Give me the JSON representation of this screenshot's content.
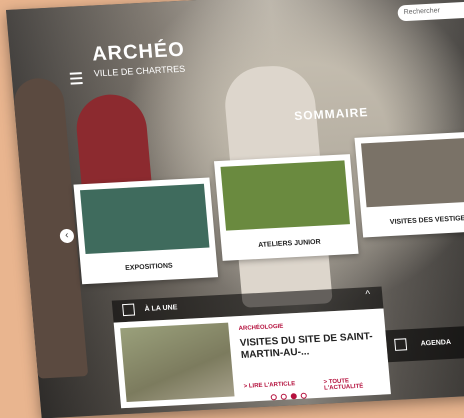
{
  "header": {
    "title": "ARCHÉO",
    "subtitle": "VILLE DE CHARTRES",
    "search_placeholder": "Rechercher"
  },
  "summary": {
    "title": "SOMMAIRE",
    "cards": [
      {
        "label": "EXPOSITIONS",
        "thumb_color": "#3f6b5d"
      },
      {
        "label": "ATELIERS JUNIOR",
        "thumb_color": "#6a8a3f"
      },
      {
        "label": "VISITES DES VESTIGES",
        "thumb_color": "#7a7267"
      }
    ],
    "prev_arrow": "‹"
  },
  "news": {
    "bar_label": "À LA UNE",
    "collapse_icon": "^",
    "category": "ARCHÉOLOGIE",
    "title": "VISITES DU SITE DE SAINT-MARTIN-AU-...",
    "read_link": "> LIRE L'ARTICLE",
    "all_link": "> TOUTE L'ACTUALITÉ",
    "dots_total": 4,
    "dots_active_index": 2
  },
  "bottom": {
    "agenda_label": "AGENDA"
  },
  "colors": {
    "accent": "#b5123e",
    "background": "#e9b58f"
  }
}
